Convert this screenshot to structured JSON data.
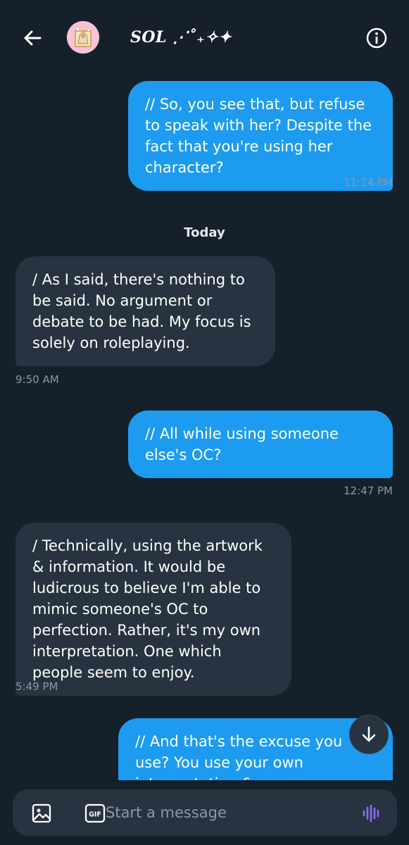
{
  "header": {
    "title": "SOL ⋰˚₊✧✦",
    "back_icon": "arrow-left-icon",
    "info_icon": "info-circle-icon"
  },
  "messages": [
    {
      "direction": "out",
      "text": "// So, you see that, but refuse to speak with her? Despite the fact that you're using her character?",
      "time": "11:24 PM"
    },
    {
      "separator": "Today"
    },
    {
      "direction": "in",
      "text": "/ As I said, there's nothing to be said. No argument or debate to be had. My focus is solely on roleplaying.",
      "time": "9:50 AM"
    },
    {
      "direction": "out",
      "text": "// All while using someone else's OC?",
      "time": "12:47 PM"
    },
    {
      "direction": "in",
      "text": "/ Technically, using the artwork & information. It would be ludicrous to believe I'm able to mimic someone's OC to perfection. Rather, it's my own interpretation. One which people seem to enjoy.",
      "time": "5:49 PM"
    },
    {
      "direction": "out",
      "text": "// And that's the excuse you use? You use your own interpretation & ",
      "time": ""
    }
  ],
  "composer": {
    "placeholder": "Start a message",
    "media_icon": "image-icon",
    "gif_icon": "gif-icon",
    "voice_icon": "voice-waveform-icon"
  },
  "scroll_button_icon": "arrow-down-icon",
  "colors": {
    "background": "#15202b",
    "outgoing_bubble": "#1d9bf0",
    "incoming_bubble": "#273340",
    "timestamp": "#8b98a5",
    "voice_accent": "#8c6cf5"
  }
}
